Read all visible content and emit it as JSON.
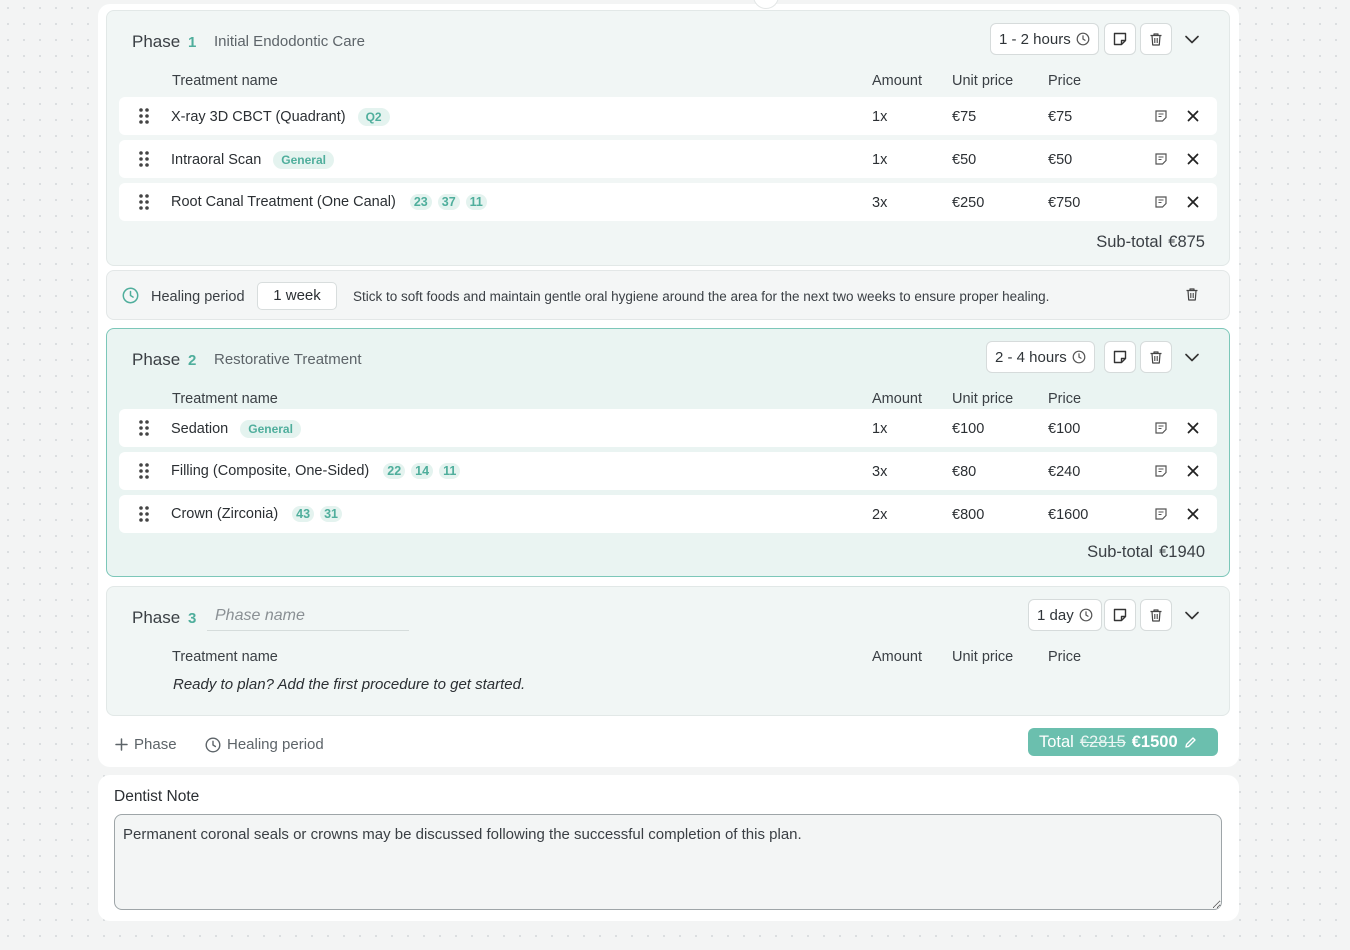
{
  "columns": {
    "name": "Treatment name",
    "amount": "Amount",
    "unit_price": "Unit price",
    "price": "Price"
  },
  "phase_label": "Phase",
  "phases": [
    {
      "number": "1",
      "name": "Initial Endodontic Care",
      "duration": "1 - 2 hours",
      "rows": [
        {
          "name": "X-ray 3D CBCT (Quadrant)",
          "tag": "Q2",
          "teeth": [],
          "amount": "1x",
          "unit_price": "€75",
          "price": "€75"
        },
        {
          "name": "Intraoral Scan",
          "tag": "General",
          "teeth": [],
          "amount": "1x",
          "unit_price": "€50",
          "price": "€50"
        },
        {
          "name": "Root Canal Treatment (One Canal)",
          "tag": "",
          "teeth": [
            "23",
            "37",
            "11"
          ],
          "amount": "3x",
          "unit_price": "€250",
          "price": "€750"
        }
      ],
      "subtotal_label": "Sub-total",
      "subtotal": "€875"
    },
    {
      "number": "2",
      "name": "Restorative Treatment",
      "duration": "2 - 4 hours",
      "rows": [
        {
          "name": "Sedation",
          "tag": "General",
          "teeth": [],
          "amount": "1x",
          "unit_price": "€100",
          "price": "€100"
        },
        {
          "name": "Filling (Composite, One-Sided)",
          "tag": "",
          "teeth": [
            "22",
            "14",
            "11"
          ],
          "amount": "3x",
          "unit_price": "€80",
          "price": "€240"
        },
        {
          "name": "Crown (Zirconia)",
          "tag": "",
          "teeth": [
            "43",
            "31"
          ],
          "amount": "2x",
          "unit_price": "€800",
          "price": "€1600"
        }
      ],
      "subtotal_label": "Sub-total",
      "subtotal": "€1940"
    },
    {
      "number": "3",
      "name_placeholder": "Phase name",
      "duration": "1 day",
      "empty_message": "Ready to plan? Add the first procedure to get started."
    }
  ],
  "healing": {
    "label": "Healing period",
    "duration": "1 week",
    "text": "Stick to soft foods and maintain gentle oral hygiene around the area for the next two weeks to ensure proper healing."
  },
  "footer": {
    "add_phase": "Phase",
    "add_healing": "Healing period",
    "total_label": "Total",
    "total_old": "€2815",
    "total_new": "€1500"
  },
  "note": {
    "title": "Dentist Note",
    "text": "Permanent coronal seals or crowns may be discussed following the successful completion of this plan."
  },
  "colors": {
    "accent": "#4fae9c",
    "total_bg": "#6bbfae",
    "active_border": "#7cc7b9"
  }
}
